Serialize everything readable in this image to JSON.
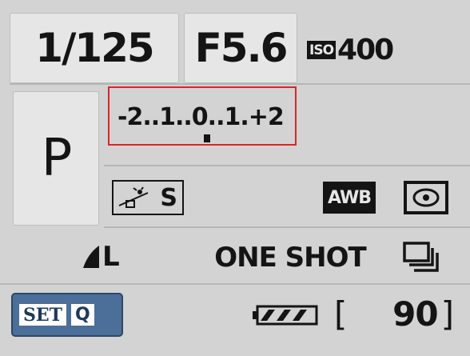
{
  "shutter_speed": "1/125",
  "aperture": "F5.6",
  "iso": {
    "badge": "ISO",
    "value": "400"
  },
  "shooting_mode": "P",
  "exposure_scale": {
    "minus_two": "-2",
    "dots1": "..",
    "one_left": "1",
    "dots2": "..",
    "zero": "0",
    "dots3": "..",
    "one_right": "1",
    "dots4": ".",
    "plus_two": "+2"
  },
  "picture_style": "S",
  "white_balance": "AWB",
  "image_quality": "L",
  "af_mode": "ONE SHOT",
  "quick_control": {
    "set_label": "SET",
    "q_label": "Q"
  },
  "shots_remaining": "90",
  "shots_bracket_open": "[",
  "shots_bracket_close": "]",
  "accent_color": "#d9252a",
  "set_button_color": "#4b6f99"
}
